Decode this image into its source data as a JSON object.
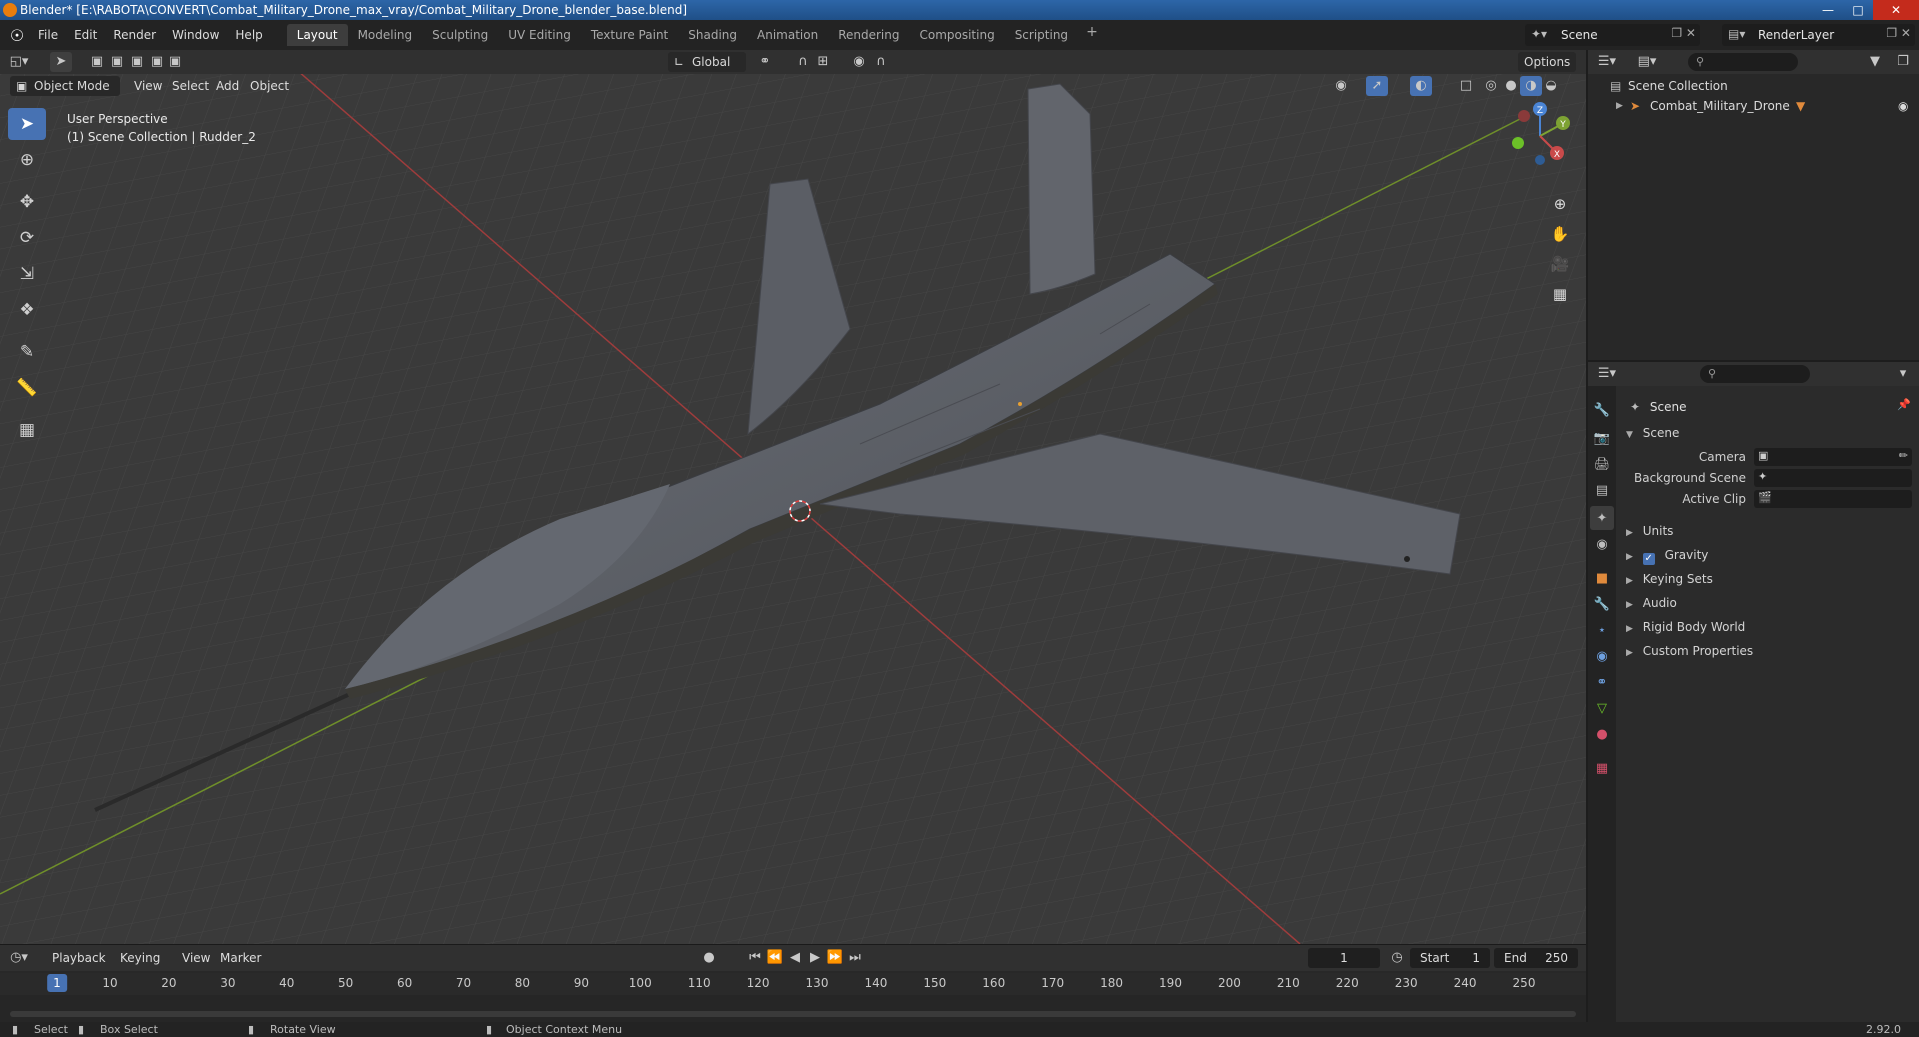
{
  "window": {
    "title": "Blender* [E:\\RABOTA\\CONVERT\\Combat_Military_Drone_max_vray/Combat_Military_Drone_blender_base.blend]"
  },
  "menu": [
    "File",
    "Edit",
    "Render",
    "Window",
    "Help"
  ],
  "workspaces": [
    "Layout",
    "Modeling",
    "Sculpting",
    "UV Editing",
    "Texture Paint",
    "Shading",
    "Animation",
    "Rendering",
    "Compositing",
    "Scripting"
  ],
  "active_workspace": "Layout",
  "scene_name": "Scene",
  "view_layer": "RenderLayer",
  "viewport": {
    "mode": "Object Mode",
    "menus": [
      "View",
      "Select",
      "Add",
      "Object"
    ],
    "transform_orientation": "Global",
    "options_label": "Options",
    "info_line1": "User Perspective",
    "info_line2": "(1) Scene Collection | Rudder_2",
    "gizmo_labels": {
      "z": "Z",
      "y": "Y",
      "x": "X"
    }
  },
  "outliner": {
    "root": "Scene Collection",
    "items": [
      {
        "name": "Combat_Military_Drone"
      }
    ]
  },
  "properties": {
    "context": "Scene",
    "panel": "Scene",
    "fields": [
      {
        "label": "Camera",
        "value": ""
      },
      {
        "label": "Background Scene",
        "value": ""
      },
      {
        "label": "Active Clip",
        "value": ""
      }
    ],
    "subpanels": [
      "Units",
      "Gravity",
      "Keying Sets",
      "Audio",
      "Rigid Body World",
      "Custom Properties"
    ],
    "gravity_checked": true
  },
  "timeline": {
    "menus": [
      "Playback",
      "Keying",
      "View",
      "Marker"
    ],
    "current_frame": "1",
    "start_label": "Start",
    "start": "1",
    "end_label": "End",
    "end": "250",
    "ticks": [
      "1",
      "10",
      "20",
      "30",
      "40",
      "50",
      "60",
      "70",
      "80",
      "90",
      "100",
      "110",
      "120",
      "130",
      "140",
      "150",
      "160",
      "170",
      "180",
      "190",
      "200",
      "210",
      "220",
      "230",
      "240",
      "250"
    ]
  },
  "statusbar": {
    "select": "Select",
    "box_select": "Box Select",
    "rotate_view": "Rotate View",
    "context_menu": "Object Context Menu",
    "version": "2.92.0"
  },
  "colors": {
    "accent": "#4772b3",
    "x_axis": "#c94a4a",
    "y_axis": "#7da233",
    "z_axis": "#4a84d4"
  }
}
